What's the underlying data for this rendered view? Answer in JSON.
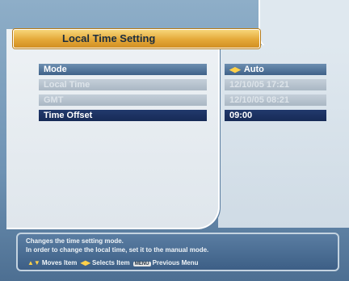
{
  "title": "Local Time Setting",
  "settings": [
    {
      "label": "Mode",
      "value": "Auto",
      "state": "active"
    },
    {
      "label": "Local Time",
      "value": "12/10/05 17:21",
      "state": "disabled"
    },
    {
      "label": "GMT",
      "value": "12/10/05 08:21",
      "state": "disabled"
    },
    {
      "label": "Time Offset",
      "value": "09:00",
      "state": "selected"
    }
  ],
  "help": {
    "line1": "Changes the time setting mode.",
    "line2": "In order to change the local time, set it to the manual mode.",
    "keys": {
      "moves": "Moves Item",
      "selects": "Selects Item",
      "menu_key": "MENU",
      "previous": "Previous Menu"
    }
  },
  "colors": {
    "title_bar": "#e4a838",
    "active_row": "#4f739b",
    "selected_row": "#1f3565",
    "disabled_row": "#b7c4d0"
  },
  "icons": {
    "mode_value": "left-right-arrows-icon",
    "moves": "up-down-arrows-icon",
    "selects": "left-right-arrows-icon",
    "menu": "menu-key-icon"
  }
}
